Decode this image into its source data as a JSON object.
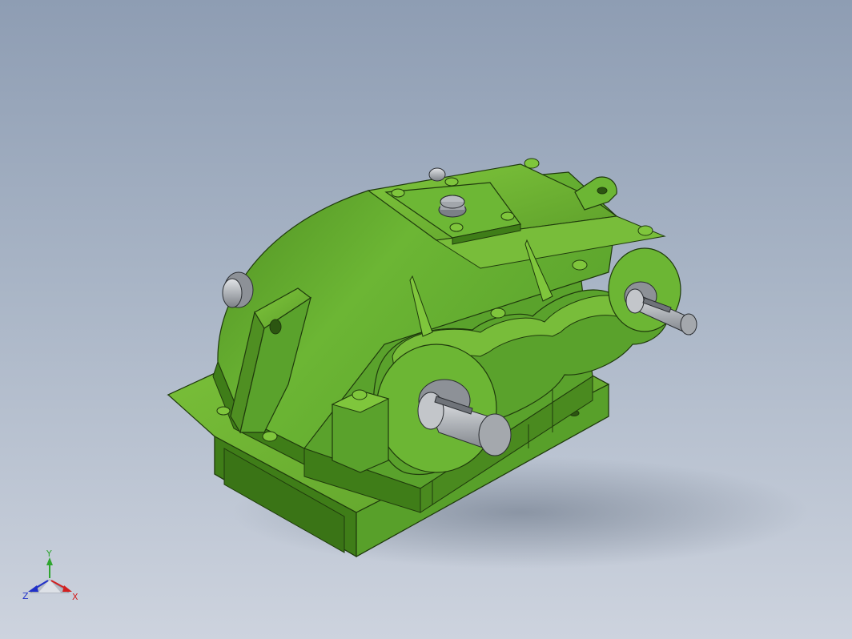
{
  "viewport": {
    "background_top": "#8e9db3",
    "background_bottom": "#cdd3de"
  },
  "model": {
    "name": "gear-reducer",
    "color_main": "#62ad2c",
    "color_light": "#7fc63c",
    "color_dark": "#3f7d18",
    "color_shaft": "#b5b8bd"
  },
  "triad": {
    "x_label": "X",
    "y_label": "Y",
    "z_label": "Z",
    "x_color": "#d22020",
    "y_color": "#2fa52f",
    "z_color": "#2030c8"
  }
}
